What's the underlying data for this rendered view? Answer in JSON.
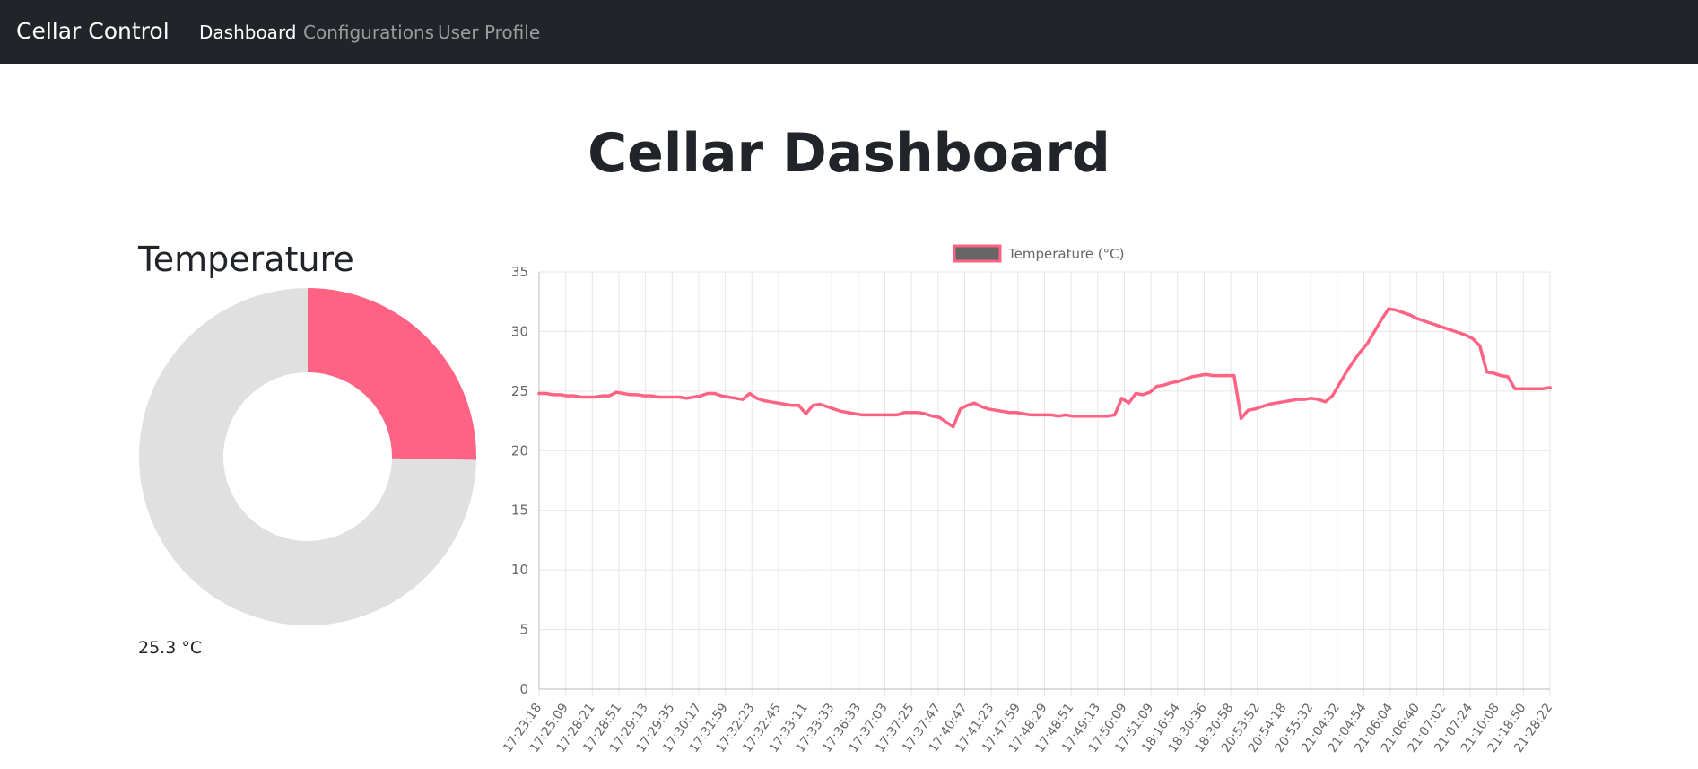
{
  "navbar": {
    "brand": "Cellar Control",
    "links": [
      {
        "label": "Dashboard",
        "active": true
      },
      {
        "label": "Configurations",
        "active": false
      },
      {
        "label": "User Profile",
        "active": false
      }
    ]
  },
  "page": {
    "title": "Cellar Dashboard"
  },
  "temperature_panel": {
    "title": "Temperature",
    "value_label": "25.3 °C",
    "gauge_fraction": 0.253,
    "gauge_colors": {
      "value": "#ff6384",
      "remainder": "#e0e0e0"
    }
  },
  "colors": {
    "navbar": "#212529",
    "accent": "#ff6384",
    "legend_box_fill": "#666666"
  },
  "chart_data": {
    "type": "line",
    "title": "",
    "xlabel": "",
    "ylabel": "",
    "ylim": [
      0,
      35
    ],
    "yticks": [
      0,
      5,
      10,
      15,
      20,
      25,
      30,
      35
    ],
    "grid": true,
    "legend_position": "top",
    "x_tick_labels": [
      "17:23:18",
      "17:25:09",
      "17:28:21",
      "17:28:51",
      "17:29:13",
      "17:29:35",
      "17:30:17",
      "17:31:59",
      "17:32:23",
      "17:32:45",
      "17:33:11",
      "17:33:33",
      "17:36:33",
      "17:37:03",
      "17:37:25",
      "17:37:47",
      "17:40:47",
      "17:41:23",
      "17:47:59",
      "17:48:29",
      "17:48:51",
      "17:49:13",
      "17:50:09",
      "17:51:09",
      "18:16:54",
      "18:30:36",
      "18:30:58",
      "20:53:52",
      "20:54:18",
      "20:55:32",
      "21:04:32",
      "21:04:54",
      "21:06:04",
      "21:06:40",
      "21:07:02",
      "21:07:24",
      "21:10:08",
      "21:18:50",
      "21:28:22"
    ],
    "series": [
      {
        "name": "Temperature (°C)",
        "color": "#ff6384",
        "values": [
          24.8,
          24.8,
          24.7,
          24.7,
          24.6,
          24.6,
          24.5,
          24.5,
          24.5,
          24.6,
          24.6,
          24.9,
          24.8,
          24.7,
          24.7,
          24.6,
          24.6,
          24.5,
          24.5,
          24.5,
          24.5,
          24.4,
          24.5,
          24.6,
          24.8,
          24.8,
          24.6,
          24.5,
          24.4,
          24.3,
          24.8,
          24.4,
          24.2,
          24.1,
          24.0,
          23.9,
          23.8,
          23.8,
          23.1,
          23.8,
          23.9,
          23.7,
          23.5,
          23.3,
          23.2,
          23.1,
          23.0,
          23.0,
          23.0,
          23.0,
          23.0,
          23.0,
          23.2,
          23.2,
          23.2,
          23.1,
          22.9,
          22.8,
          22.4,
          22.0,
          23.5,
          23.8,
          24.0,
          23.7,
          23.5,
          23.4,
          23.3,
          23.2,
          23.2,
          23.1,
          23.0,
          23.0,
          23.0,
          23.0,
          22.9,
          23.0,
          22.9,
          22.9,
          22.9,
          22.9,
          22.9,
          22.9,
          23.0,
          24.4,
          24.0,
          24.8,
          24.7,
          24.9,
          25.4,
          25.5,
          25.7,
          25.8,
          26.0,
          26.2,
          26.3,
          26.4,
          26.3,
          26.3,
          26.3,
          26.3,
          22.7,
          23.4,
          23.5,
          23.7,
          23.9,
          24.0,
          24.1,
          24.2,
          24.3,
          24.3,
          24.4,
          24.3,
          24.1,
          24.6,
          25.6,
          26.6,
          27.5,
          28.3,
          29.0,
          30.0,
          31.0,
          31.9,
          31.8,
          31.6,
          31.4,
          31.1,
          30.9,
          30.7,
          30.5,
          30.3,
          30.1,
          29.9,
          29.7,
          29.4,
          28.8,
          26.6,
          26.5,
          26.3,
          26.2,
          25.2,
          25.2,
          25.2,
          25.2,
          25.2,
          25.3
        ]
      }
    ]
  }
}
